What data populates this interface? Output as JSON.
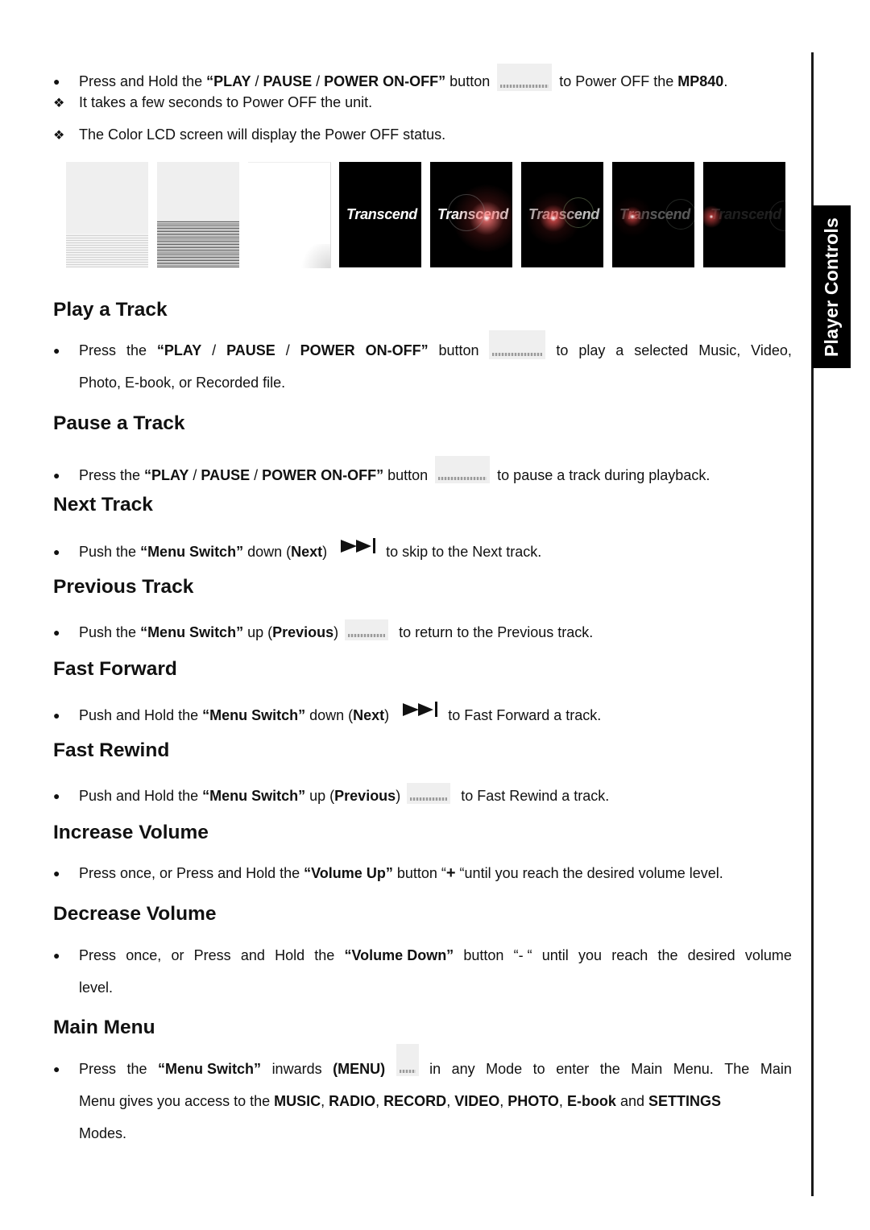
{
  "side_tab": {
    "label": "Player Controls"
  },
  "power_off": {
    "bullet": [
      "Press and Hold the ",
      "“PLAY",
      " / ",
      "PAUSE",
      " / ",
      "POWER ON-OFF”",
      " button ",
      " to Power OFF the ",
      "MP840",
      "."
    ],
    "notes": [
      "It takes a few seconds to Power OFF the unit.",
      "The Color LCD screen will display the Power OFF status."
    ]
  },
  "screens": {
    "logo_text": "Transcend",
    "frames": [
      "blank-light",
      "noise-light",
      "white",
      "logo",
      "logo-flare-1",
      "logo-flare-2",
      "logo-flare-3",
      "logo-flare-4"
    ]
  },
  "sections": {
    "play": {
      "title": "Play a Track",
      "t1": "Press",
      "t2": "the",
      "t3": "“PLAY",
      "t4": "/",
      "t5": "PAUSE",
      "t6": "/",
      "t7": "POWER",
      "t8": "ON-OFF”",
      "t9": "button",
      "t10": "to",
      "t11": "play",
      "t12": "a",
      "t13": "selected",
      "t14": "Music,",
      "t15": "Video,",
      "line2": "Photo, E-book, or Recorded file."
    },
    "pause": {
      "title": "Pause a Track",
      "pre": "Press the ",
      "b1": "“PLAY",
      "s1": " / ",
      "b2": "PAUSE",
      "s2": " / ",
      "b3": "POWER ON-OFF”",
      "mid": " button ",
      "post": " to pause a track during playback."
    },
    "next": {
      "title": "Next Track",
      "pre": "Push the ",
      "b1": "“Menu Switch”",
      "mid": " down (",
      "b2": "Next",
      "close": ")",
      "post": "to skip to the Next track.",
      "icon": "skip-next-icon"
    },
    "previous": {
      "title": "Previous Track",
      "pre": "Push the ",
      "b1": "“Menu Switch”",
      "mid": " up (",
      "b2": "Previous",
      "close": ")",
      "post": " to return to the Previous track."
    },
    "fast_forward": {
      "title": "Fast Forward",
      "pre": "Push and Hold the ",
      "b1": "“Menu Switch”",
      "mid": " down (",
      "b2": "Next",
      "close": ")",
      "post": "to Fast Forward a track.",
      "icon": "skip-next-icon"
    },
    "fast_rewind": {
      "title": "Fast Rewind",
      "pre": "Push and Hold the ",
      "b1": "“Menu Switch”",
      "mid": " up (",
      "b2": "Previous",
      "close": ")",
      "post": " to Fast Rewind a track."
    },
    "increase_volume": {
      "title": "Increase Volume",
      "pre": "Press once, or Press and Hold the ",
      "b1": "“Volume Up”",
      "mid": " button “",
      "symbol": "+",
      "post": " “until you reach the desired volume level."
    },
    "decrease_volume": {
      "title": "Decrease Volume",
      "words": [
        "Press",
        "once,",
        "or",
        "Press",
        "and",
        "Hold",
        "the",
        "“Volume Down”",
        "button",
        "“- “",
        "until",
        "you",
        "reach",
        "the",
        "desired",
        "volume"
      ],
      "line2": "level."
    },
    "main_menu": {
      "title": "Main Menu",
      "l1_words": [
        "Press",
        "the",
        "“Menu Switch”",
        "inwards",
        "(MENU)",
        "in",
        "any",
        "Mode",
        "to",
        "enter",
        "the",
        "Main",
        "Menu.",
        "The",
        "Main"
      ],
      "l2_pre": "Menu gives you access to the ",
      "modes": [
        "MUSIC",
        "RADIO",
        "RECORD",
        "VIDEO",
        "PHOTO",
        "E-book",
        "SETTINGS"
      ],
      "l2_and": " and ",
      "line3": "Modes."
    }
  }
}
